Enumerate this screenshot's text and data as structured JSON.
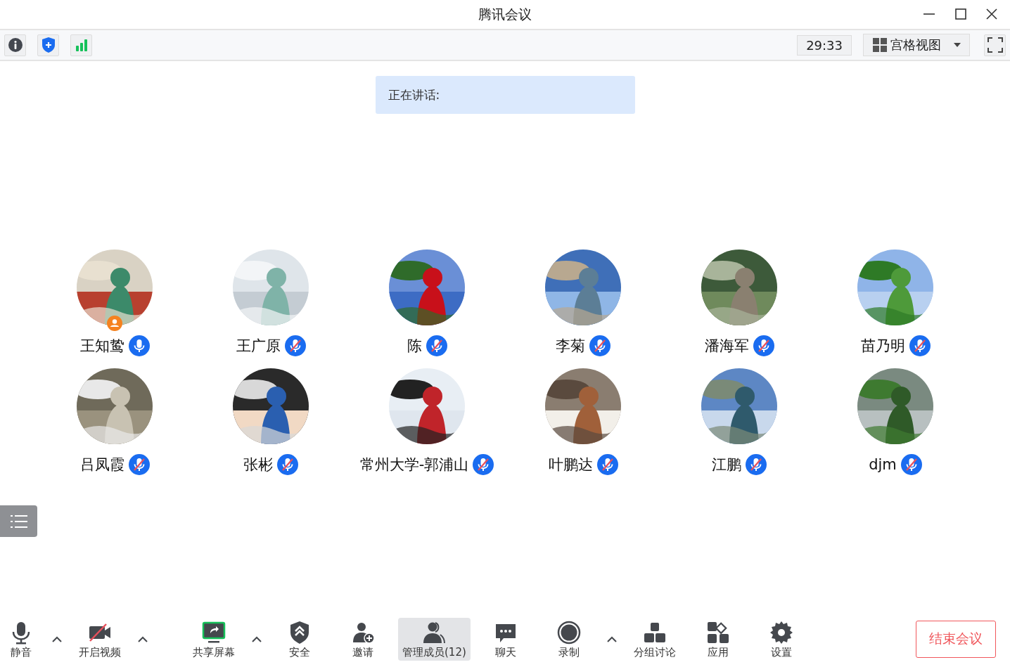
{
  "window": {
    "title": "腾讯会议"
  },
  "topbar": {
    "timer": "29:33",
    "view": "宫格视图"
  },
  "speaking": {
    "label": "正在讲话:"
  },
  "participants": [
    {
      "name": "王知鸷",
      "muted": false,
      "host": true
    },
    {
      "name": "王广原",
      "muted": true,
      "host": false
    },
    {
      "name": "陈",
      "muted": true,
      "host": false
    },
    {
      "name": "李菊",
      "muted": true,
      "host": false
    },
    {
      "name": "潘海军",
      "muted": true,
      "host": false
    },
    {
      "name": "苗乃明",
      "muted": true,
      "host": false
    },
    {
      "name": "吕凤霞",
      "muted": true,
      "host": false
    },
    {
      "name": "张彬",
      "muted": true,
      "host": false
    },
    {
      "name": "常州大学-郭浦山",
      "muted": true,
      "host": false
    },
    {
      "name": "叶鹏达",
      "muted": true,
      "host": false
    },
    {
      "name": "江鹏",
      "muted": true,
      "host": false
    },
    {
      "name": "djm",
      "muted": true,
      "host": false
    }
  ],
  "toolbar": [
    {
      "kind": "mic",
      "label": "静音",
      "caret": true,
      "selected": false
    },
    {
      "kind": "video",
      "label": "开启视频",
      "caret": true,
      "selected": false
    },
    {
      "kind": "share",
      "label": "共享屏幕",
      "caret": true,
      "selected": false
    },
    {
      "kind": "security",
      "label": "安全",
      "caret": false,
      "selected": false
    },
    {
      "kind": "invite",
      "label": "邀请",
      "caret": false,
      "selected": false
    },
    {
      "kind": "members",
      "label": "管理成员(12)",
      "caret": false,
      "selected": true
    },
    {
      "kind": "chat",
      "label": "聊天",
      "caret": false,
      "selected": false
    },
    {
      "kind": "record",
      "label": "录制",
      "caret": true,
      "selected": false
    },
    {
      "kind": "breakout",
      "label": "分组讨论",
      "caret": false,
      "selected": false
    },
    {
      "kind": "apps",
      "label": "应用",
      "caret": false,
      "selected": false
    },
    {
      "kind": "settings",
      "label": "设置",
      "caret": false,
      "selected": false
    }
  ],
  "end_button": "结束会议"
}
